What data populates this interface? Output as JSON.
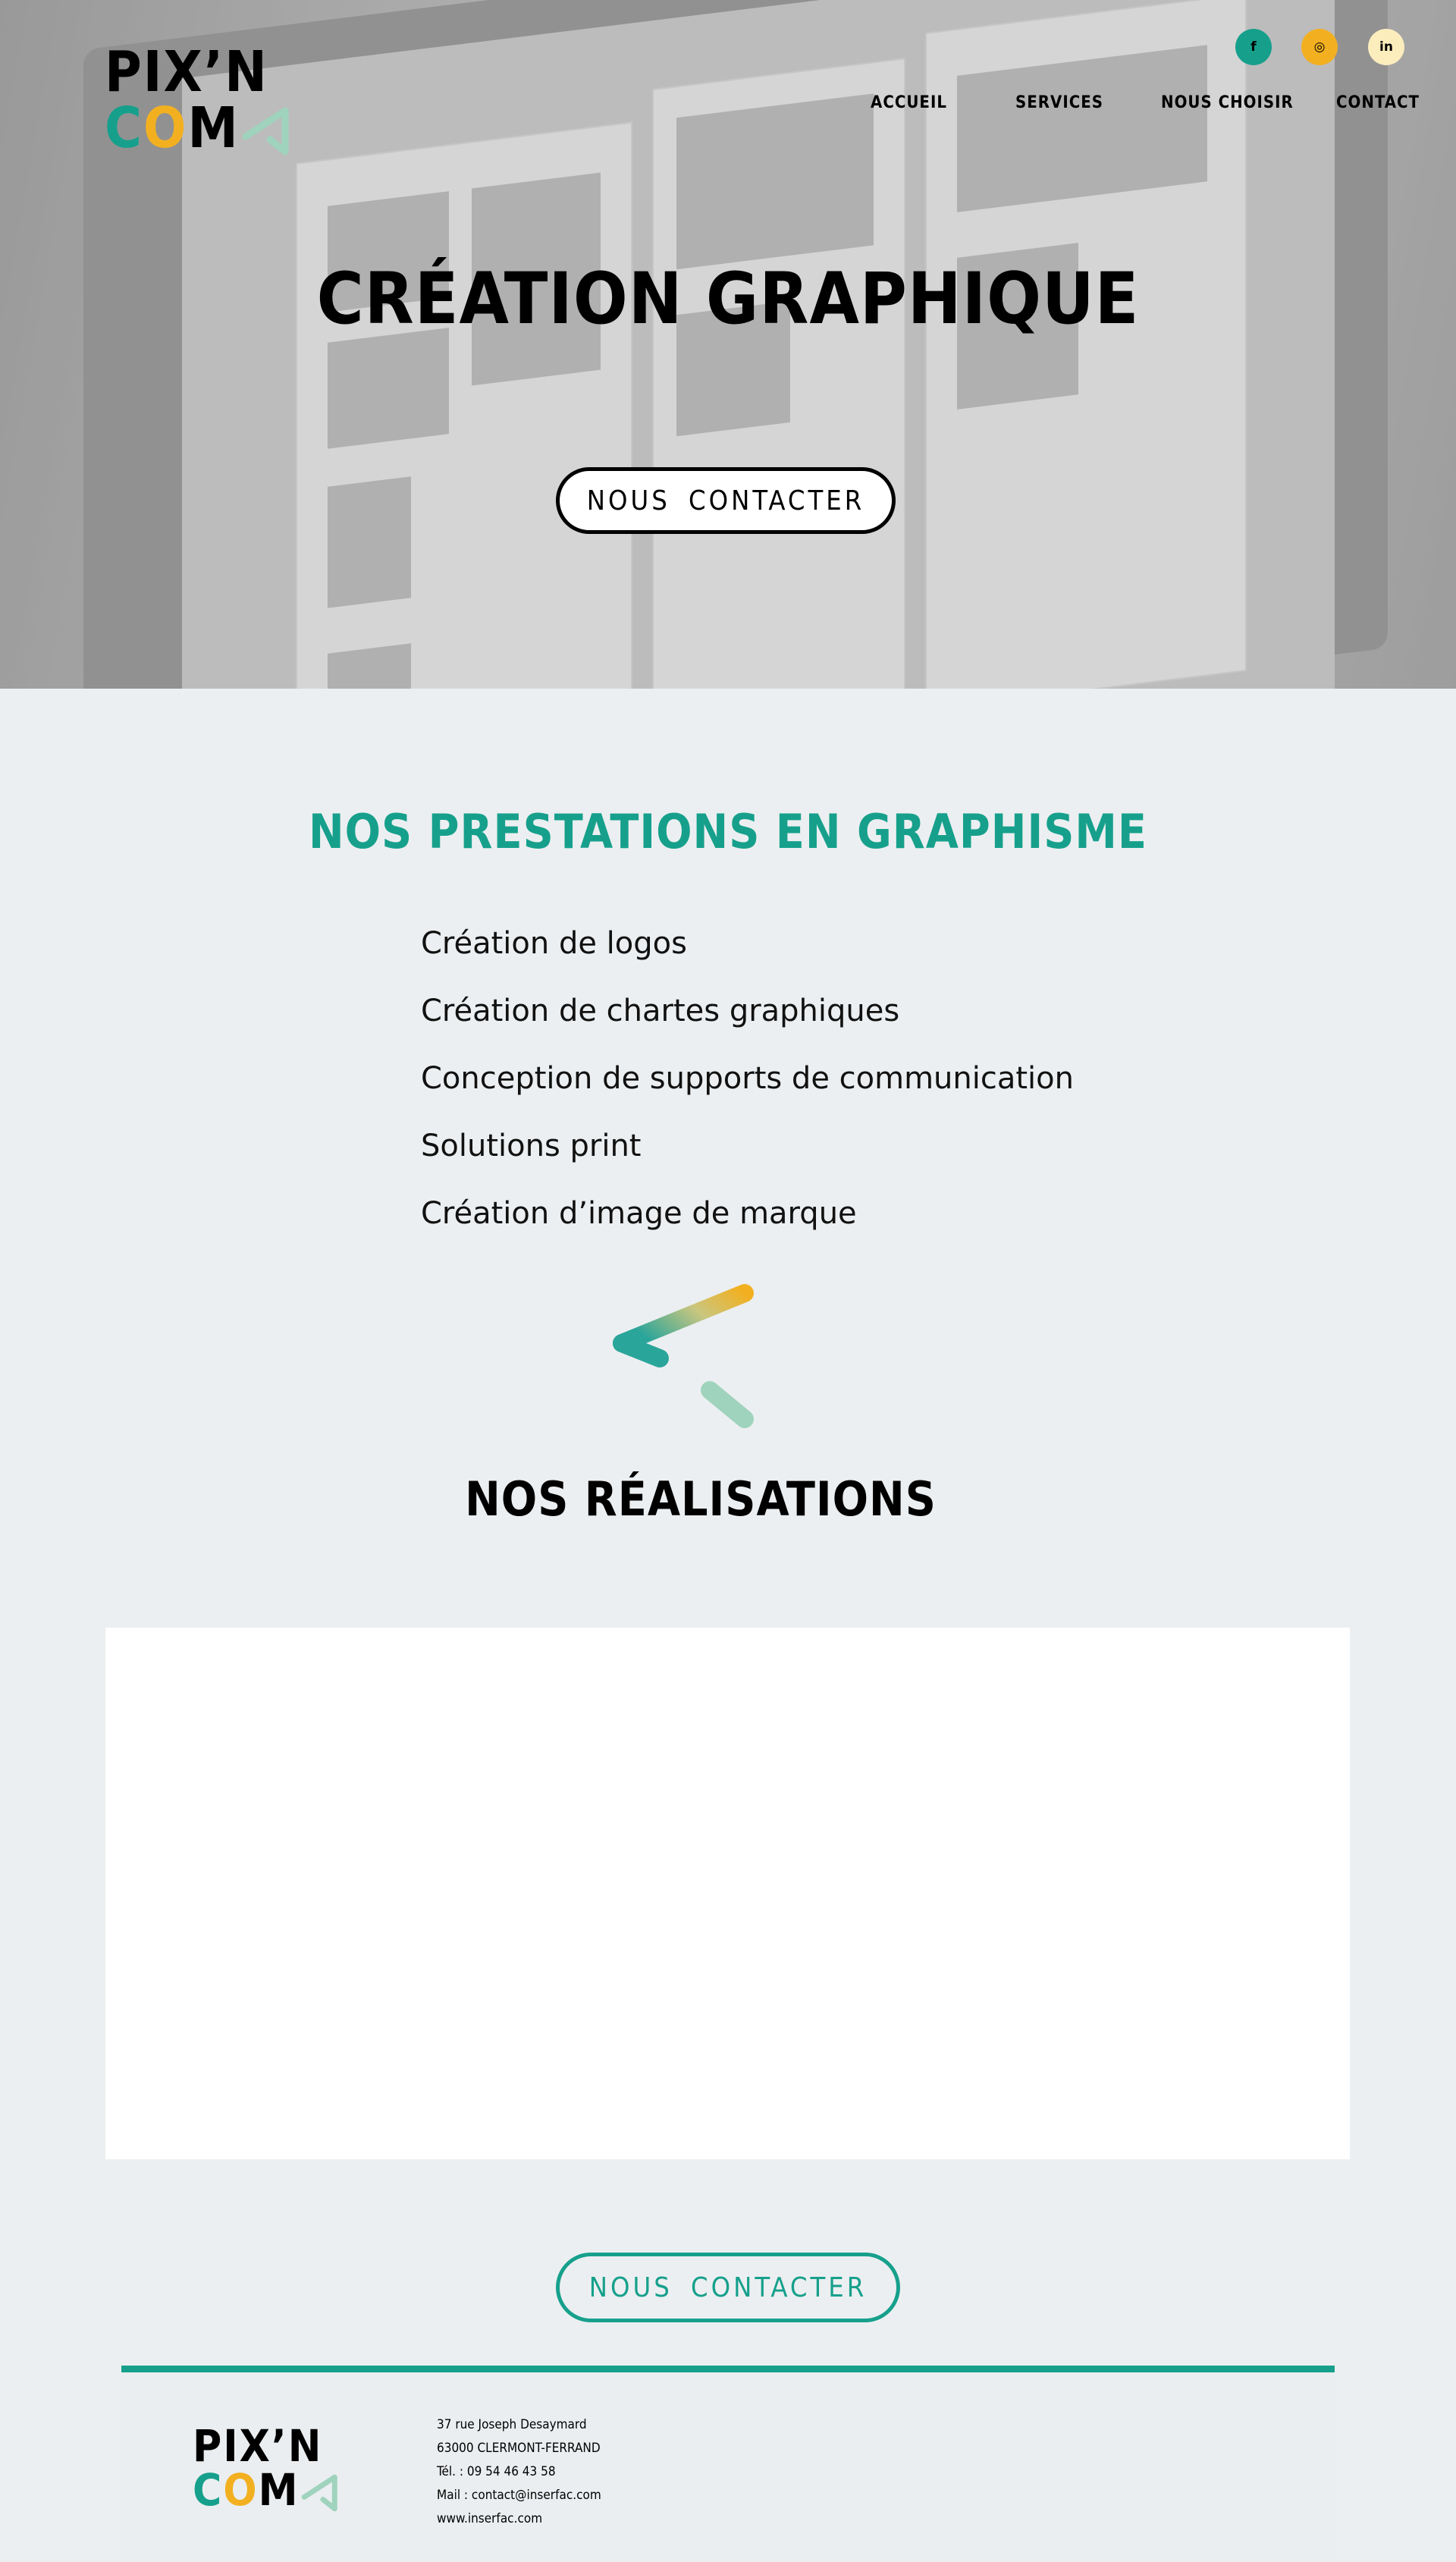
{
  "brand": {
    "logo_line1": "PIX’N",
    "logo_line2_c": "C",
    "logo_line2_o": "O",
    "logo_line2_m": "M",
    "colors": {
      "teal": "#16a08c",
      "yellow": "#f2b021",
      "mint": "#9fd3bd",
      "cream": "#fcedbd"
    }
  },
  "social": {
    "facebook": {
      "glyph": "f",
      "icon": "facebook-icon",
      "color": "#16a08c"
    },
    "instagram": {
      "glyph": "◎",
      "icon": "instagram-icon",
      "color": "#f2b021"
    },
    "linkedin": {
      "glyph": "in",
      "icon": "linkedin-icon",
      "color": "#fcedbd"
    }
  },
  "nav": {
    "items": [
      "ACCUEIL",
      "SERVICES",
      "NOUS CHOISIR",
      "CONTACT"
    ]
  },
  "hero": {
    "title": "CRÉATION GRAPHIQUE",
    "cta": "NOUS CONTACTER"
  },
  "services": {
    "title": "NOS PRESTATIONS EN GRAPHISME",
    "items": [
      "Création de logos",
      "Création de chartes graphiques",
      "Conception de supports de communication",
      "Solutions print",
      "Création d’image de marque"
    ]
  },
  "realisations": {
    "title": "NOS RÉALISATIONS"
  },
  "cta_bottom": "NOUS CONTACTER",
  "footer": {
    "address_line1": "37 rue Joseph Desaymard",
    "address_line2": "63000 CLERMONT-FERRAND",
    "phone": "Tél. : 09 54 46 43 58",
    "mail": "Mail : contact@inserfac.com",
    "web": "www.inserfac.com"
  }
}
